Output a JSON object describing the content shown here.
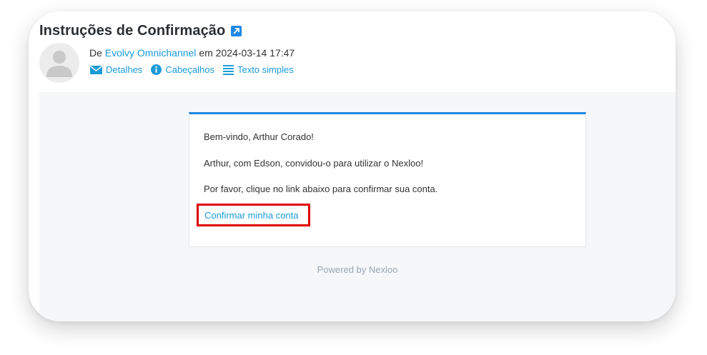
{
  "email": {
    "subject": "Instruções de Confirmação",
    "from_prefix": "De",
    "sender": "Evolvy Omnichannel",
    "date_prefix": "em",
    "datetime": "2024-03-14 17:47",
    "actions": [
      {
        "label": "Detalhes",
        "icon": "envelope-icon"
      },
      {
        "label": "Cabeçalhos",
        "icon": "info-icon"
      },
      {
        "label": "Texto simples",
        "icon": "lines-icon"
      }
    ]
  },
  "message": {
    "greeting": "Bem-vindo, Arthur Corado!",
    "invite": "Arthur, com Edson, convidou-o para utilizar o Nexloo!",
    "instruction": "Por favor, clique no link abaixo para confirmar sua conta.",
    "confirm_link": "Confirmar minha conta",
    "footer": "Powered by Nexloo"
  },
  "colors": {
    "accent": "#1e88e5",
    "link": "#1a9bd7",
    "highlight": "#e00000"
  }
}
